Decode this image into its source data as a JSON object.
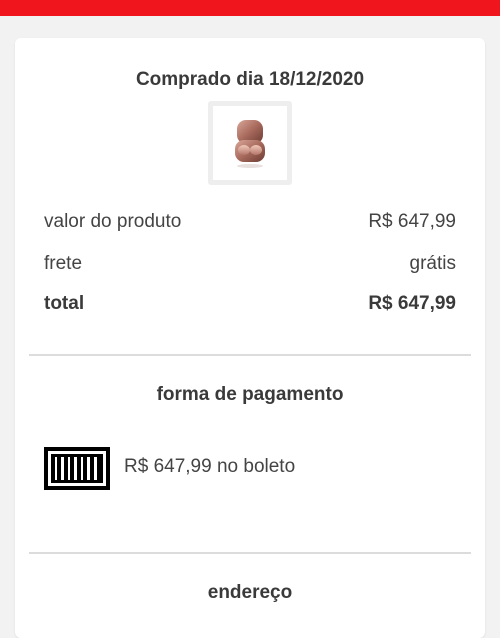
{
  "order": {
    "purchase_title": "Comprado dia 18/12/2020",
    "product_image_icon": "earbuds-case-icon"
  },
  "summary": {
    "rows": [
      {
        "label": "valor do produto",
        "value": "R$ 647,99"
      },
      {
        "label": "frete",
        "value": "grátis"
      },
      {
        "label": "total",
        "value": "R$ 647,99"
      }
    ]
  },
  "payment": {
    "section_title": "forma de pagamento",
    "method_icon": "barcode-icon",
    "description": "R$ 647,99 no boleto"
  },
  "address": {
    "section_title": "endereço"
  },
  "colors": {
    "top_bar": "#f0151c",
    "card_background": "#ffffff",
    "page_background": "#f2f2f2"
  }
}
